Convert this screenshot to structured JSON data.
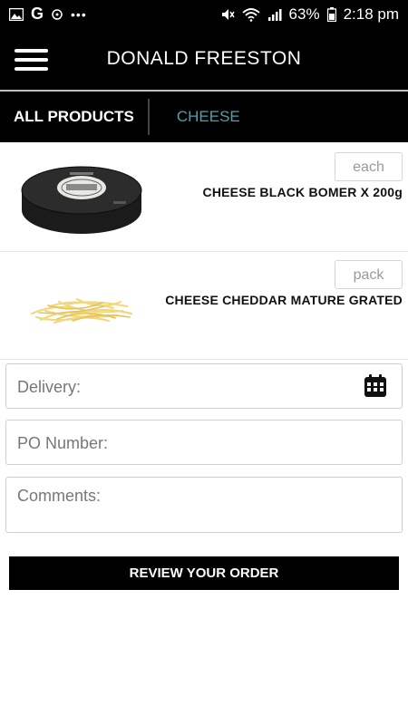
{
  "status_bar": {
    "icons_left": [
      "image-icon",
      "google-icon",
      "notification-icon",
      "more-icon"
    ],
    "g_glyph": "G",
    "dots": "•••",
    "battery": "63%",
    "time": "2:18 pm"
  },
  "header": {
    "title": "DONALD FREESTON"
  },
  "tabs": [
    {
      "label": "ALL PRODUCTS",
      "active": false
    },
    {
      "label": "CHEESE",
      "active": true
    }
  ],
  "products": [
    {
      "name": "CHEESE BLACK BOMER X 200g",
      "unit": "each",
      "image": "black-bomber-cheese"
    },
    {
      "name": "CHEESE CHEDDAR MATURE GRATED",
      "unit": "pack",
      "image": "grated-cheddar"
    }
  ],
  "form": {
    "delivery_placeholder": "Delivery:",
    "po_placeholder": "PO Number:",
    "comments_placeholder": "Comments:"
  },
  "actions": {
    "review_label": "REVIEW YOUR ORDER"
  },
  "colors": {
    "active_tab": "#4fa0ad",
    "bar_background": "#000000"
  }
}
